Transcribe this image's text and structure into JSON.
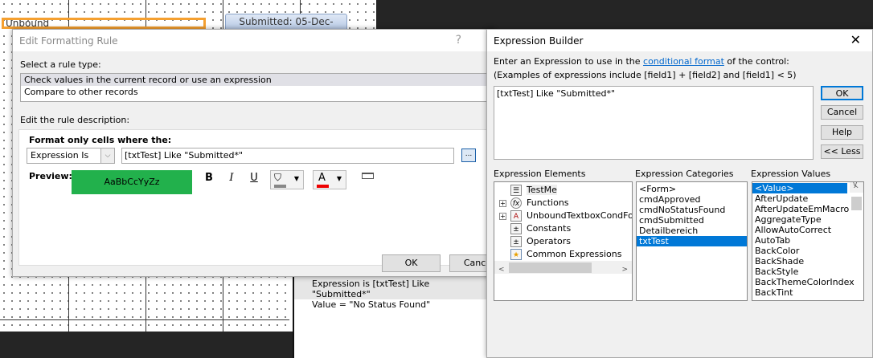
{
  "background": {
    "unbound_label": "Unbound",
    "submitted_label": "Submitted: 05-Dec-"
  },
  "manager": {
    "rule_text": "Expression is [txtTest] Like \"Submitted*\"",
    "value_text": "Value = \"No Status Found\""
  },
  "edit_rule": {
    "title": "Edit Formatting Rule",
    "help": "?",
    "select_label": "Select a rule type:",
    "rule_types": [
      "Check values in the current record or use an expression",
      "Compare to other records"
    ],
    "desc_label": "Edit the rule description:",
    "format_label": "Format only cells where the:",
    "condition": "Expression Is",
    "expression": "[txtTest] Like \"Submitted*\"",
    "builder_button": "...",
    "preview_label": "Preview:",
    "preview_text": "AaBbCcYyZz",
    "preview_color": "#22b14c",
    "bold": "B",
    "italic": "I",
    "underline": "U",
    "font_color_glyph": "A",
    "ok": "OK",
    "cancel": "Cancel"
  },
  "expr_builder": {
    "title": "Expression Builder",
    "close": "✕",
    "instr_pre": "Enter an Expression to use in the ",
    "instr_link": "conditional format",
    "instr_post": " of the control:",
    "examples": "(Examples of expressions include [field1] + [field2] and [field1] < 5)",
    "expression": "[txtTest] Like \"Submitted*\"",
    "ok": "OK",
    "cancel": "Cancel",
    "help": "Help",
    "less": "<< Less",
    "elements_label": "Expression Elements",
    "categories_label": "Expression Categories",
    "values_label": "Expression Values",
    "elements": [
      {
        "label": "TestMe",
        "icon": "form-icon",
        "expandable": false
      },
      {
        "label": "Functions",
        "icon": "function-icon",
        "expandable": true
      },
      {
        "label": "UnboundTextboxCondFormat",
        "icon": "access-db-icon",
        "expandable": true
      },
      {
        "label": "Constants",
        "icon": "constants-icon",
        "expandable": false
      },
      {
        "label": "Operators",
        "icon": "operators-icon",
        "expandable": false
      },
      {
        "label": "Common Expressions",
        "icon": "common-expressions-icon",
        "expandable": false
      }
    ],
    "categories": [
      "<Form>",
      "cmdApproved",
      "cmdNoStatusFound",
      "cmdSubmitted",
      "Detailbereich",
      "txtTest"
    ],
    "selected_category": "txtTest",
    "values": [
      "<Value>",
      "AfterUpdate",
      "AfterUpdateEmMacro",
      "AggregateType",
      "AllowAutoCorrect",
      "AutoTab",
      "BackColor",
      "BackShade",
      "BackStyle",
      "BackThemeColorIndex",
      "BackTint"
    ],
    "selected_value": "<Value>"
  }
}
